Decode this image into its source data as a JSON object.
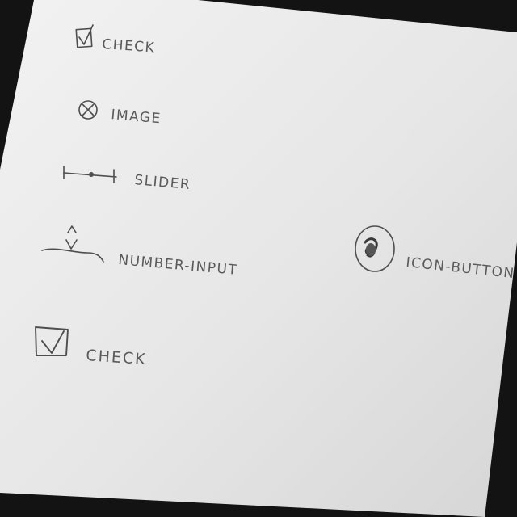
{
  "sketch": {
    "items": [
      {
        "label": "CHECK",
        "icon": "checked-checkbox-icon"
      },
      {
        "label": "IMAGE",
        "icon": "image-placeholder-icon"
      },
      {
        "label": "SLIDER",
        "icon": "slider-icon"
      },
      {
        "label": "NUMBER-INPUT",
        "icon": "number-stepper-icon"
      },
      {
        "label": "CHECK",
        "icon": "checked-checkbox-icon"
      },
      {
        "label": "ICON-BUTTON",
        "icon": "circle-icon-button-icon"
      }
    ]
  },
  "colors": {
    "background": "#131313",
    "paper": "#e8e8e8",
    "ink": "#4e4e4e"
  }
}
